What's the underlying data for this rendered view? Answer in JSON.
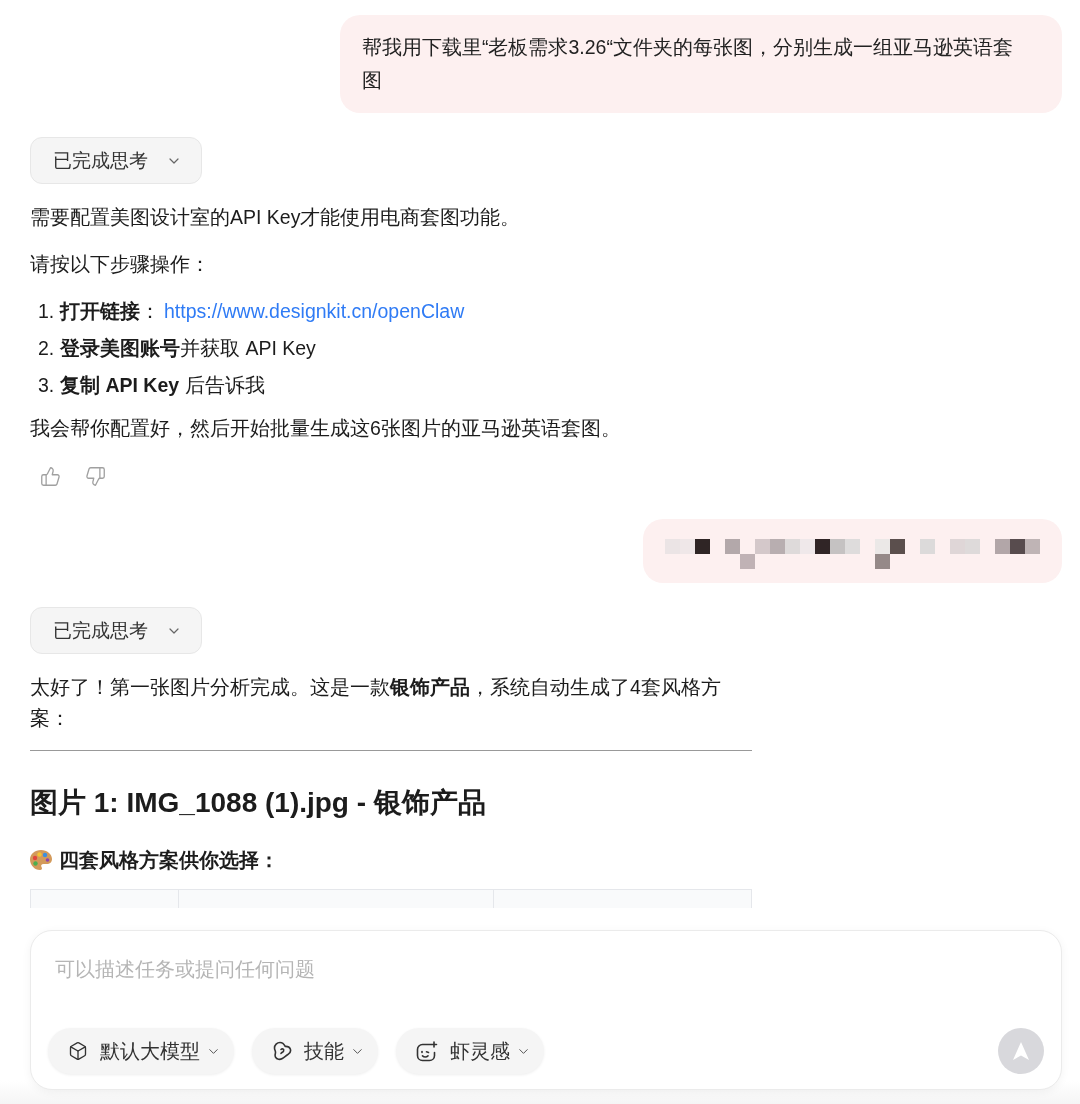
{
  "conversation": [
    {
      "kind": "user",
      "text": "帮我用下载里“老板需求3.26“文件夹的每张图，分别生成一组亚马逊英语套图"
    },
    {
      "kind": "assistant",
      "thinking": {
        "label": "已完成思考",
        "expanded": false
      },
      "blocks": [
        {
          "kind": "paragraph",
          "text": "需要配置美图设计室的API Key才能使用电商套图功能。"
        },
        {
          "kind": "paragraph",
          "text": "请按以下步骤操作："
        },
        {
          "kind": "ordered_list",
          "items": [
            {
              "number": "1.",
              "text": "**打开链接**：",
              "link": "https://www.designkit.cn/openClaw"
            },
            {
              "number": "2.",
              "text": "**登录美图账号**并获取 API Key"
            },
            {
              "number": "3.",
              "text": "**复制 API Key** 后告诉我"
            }
          ]
        },
        {
          "kind": "paragraph",
          "text": "我会帮你配置好，然后开始批量生成这6张图片的亚马逊英语套图。"
        }
      ],
      "feedback_buttons": true
    },
    {
      "kind": "user_pixelated"
    },
    {
      "kind": "assistant",
      "thinking": {
        "label": "已完成思考",
        "expanded": false
      },
      "blocks": [
        {
          "kind": "paragraph",
          "text": "太好了！第一张图片分析完成。这是一款**银饰产品**，系统自动生成了4套风格方案："
        },
        {
          "kind": "rule"
        },
        {
          "kind": "heading",
          "text": "图片 1: IMG_1088 (1).jpg - 银饰产品"
        },
        {
          "kind": "subheading",
          "text": "四套风格方案供你选择："
        },
        {
          "kind": "table"
        }
      ]
    }
  ],
  "composer": {
    "placeholder": "可以描述任务或提问任何问题",
    "chips": [
      {
        "label": "默认大模型"
      },
      {
        "label": "技能"
      },
      {
        "label": "虾灵感"
      }
    ],
    "send_button": {
      "disabled": true
    }
  }
}
